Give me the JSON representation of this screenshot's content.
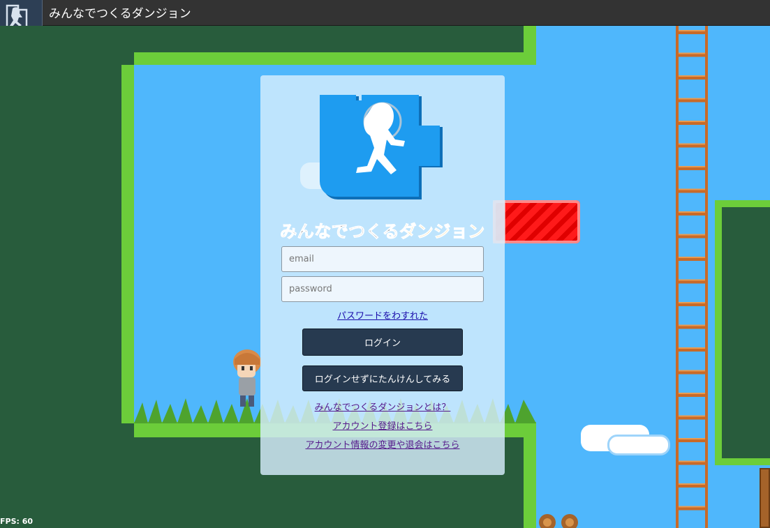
{
  "window": {
    "title": "みんなでつくるダンジョン",
    "icon": "runner-puzzle-icon"
  },
  "login": {
    "logo_text_part1": "みんなでつくる",
    "logo_text_part2": "ダンジョン",
    "email_placeholder": "email",
    "password_placeholder": "password",
    "forgot_password": "パスワードをわすれた",
    "login_button": "ログイン",
    "guest_button": "ログインせずにたんけんしてみる",
    "about_link": "みんなでつくるダンジョンとは？",
    "register_link": "アカウント登録はこちら",
    "account_link": "アカウント情報の変更や退会はこちら"
  },
  "status": {
    "fps": "FPS: 60"
  },
  "colors": {
    "topbar": "#333333",
    "button": "#273a50",
    "sky": "#4fb7fc",
    "grass": "#6ccd3a",
    "ground": "#285c3c",
    "logo_blue": "#1e9cf0",
    "logo_accent": "#f0a818",
    "link_blue": "#1a0dab",
    "link_visited": "#551a8b"
  }
}
